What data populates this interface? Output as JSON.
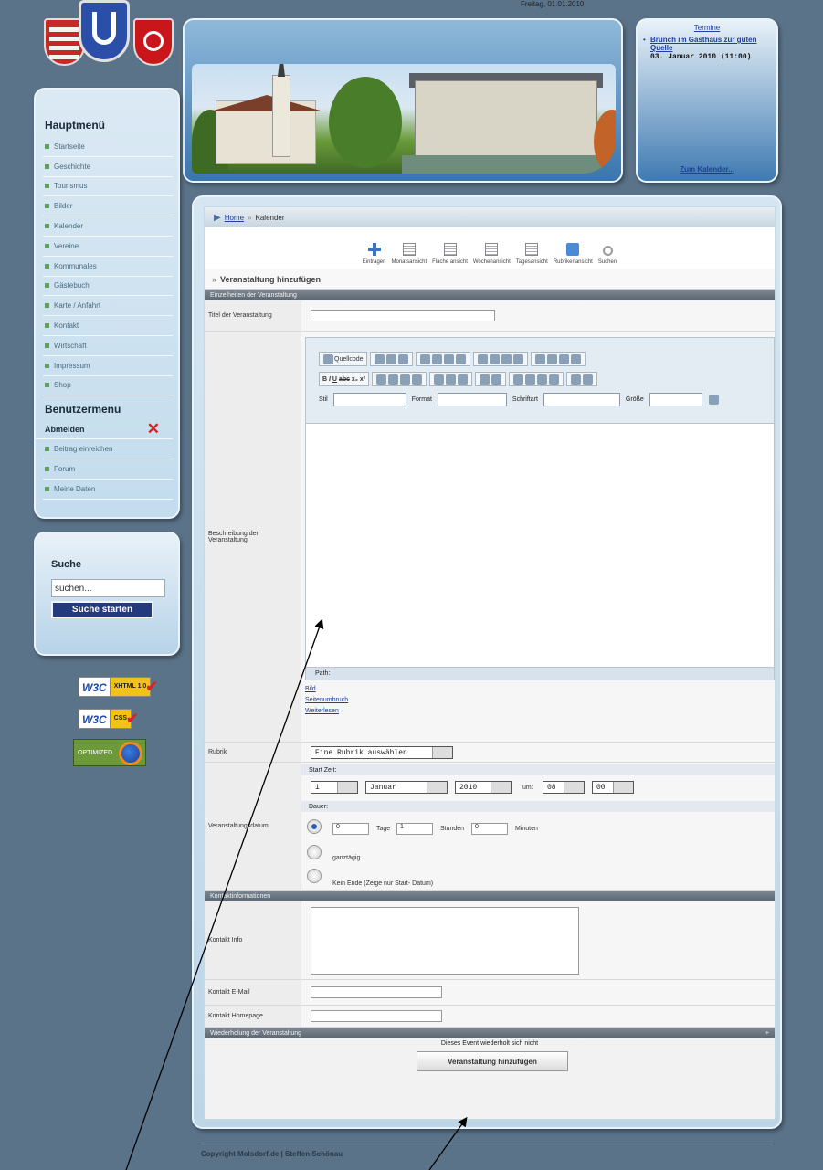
{
  "header": {
    "date_text": "Freitag, 01.01.2010"
  },
  "menu": {
    "title": "Hauptmenü",
    "items": [
      "Startseite",
      "Geschichte",
      "Tourismus",
      "Bilder",
      "Kalender",
      "Vereine",
      "Kommunales",
      "Gästebuch",
      "Karte / Anfahrt",
      "Kontakt",
      "Wirtschaft",
      "Impressum",
      "Shop"
    ],
    "user_title": "Benutzermenu",
    "logout_label": "Abmelden",
    "user_items": [
      "Beitrag einreichen",
      "Forum",
      "Meine Daten"
    ]
  },
  "search": {
    "title": "Suche",
    "value": "suchen...",
    "button": "Suche starten"
  },
  "badges": {
    "xhtml": "XHTML 1.0",
    "css": "CSS",
    "w3c": "W3C",
    "firefox": "OPTIMIZED"
  },
  "events": {
    "heading": "Termine",
    "item_title": "Brunch im Gasthaus zur guten Quelle",
    "item_date": "03. Januar 2010 (11:00)",
    "more": "Zum Kalender..."
  },
  "content": {
    "breadcrumb_home": "Home",
    "breadcrumb_sep": "»",
    "breadcrumb_current": "Kalender",
    "toolbar": [
      "Eintragen",
      "Monatsansicht",
      "Flache ansicht",
      "Wochenansicht",
      "Tagesansicht",
      "Rubrikenansicht",
      "Suchen"
    ],
    "section_title": "Veranstaltung hinzufügen",
    "bar_details": "Einzelheiten der Veranstaltung",
    "label_title": "Titel der Veranstaltung",
    "label_description": "Beschreibung der Veranstaltung",
    "editor_path": "Path:",
    "editor_selects": [
      "Stil",
      "Format",
      "Schriftart",
      "Größe"
    ],
    "editor_source": "Quellcode",
    "links": [
      "Bild",
      "Seitenumbruch",
      "Weiterlesen"
    ],
    "label_category": "Rubrik",
    "category_value": "Eine Rubrik auswählen",
    "label_date": "Veranstaltungsdatum",
    "start_label": "Start Zeit:",
    "start_day": "1",
    "start_month": "Januar",
    "start_year": "2010",
    "at_label": "um:",
    "start_hour": "08",
    "start_min": "00",
    "duration_label": "Dauer:",
    "dur_days": "0",
    "dur_days_label": "Tage",
    "dur_hours": "1",
    "dur_hours_label": "Stunden",
    "dur_min": "0",
    "dur_min_label": "Minuten",
    "allday_label": "ganztägig",
    "noend_label": "Kein Ende (Zeige nur Start- Datum)",
    "bar_contact": "Kontaktinformationen",
    "label_contact_info": "Kontakt Info",
    "label_contact_email": "Kontakt E-Mail",
    "label_contact_homepage": "Kontakt Homepage",
    "bar_repeat": "Wiederholung der Veranstaltung",
    "bar_repeat_icon": "+",
    "repeat_text": "Dieses Event wiederholt sich nicht",
    "submit": "Veranstaltung hinzufügen"
  },
  "footer": {
    "text": "Copyright Molsdorf.de | Steffen Schönau"
  }
}
